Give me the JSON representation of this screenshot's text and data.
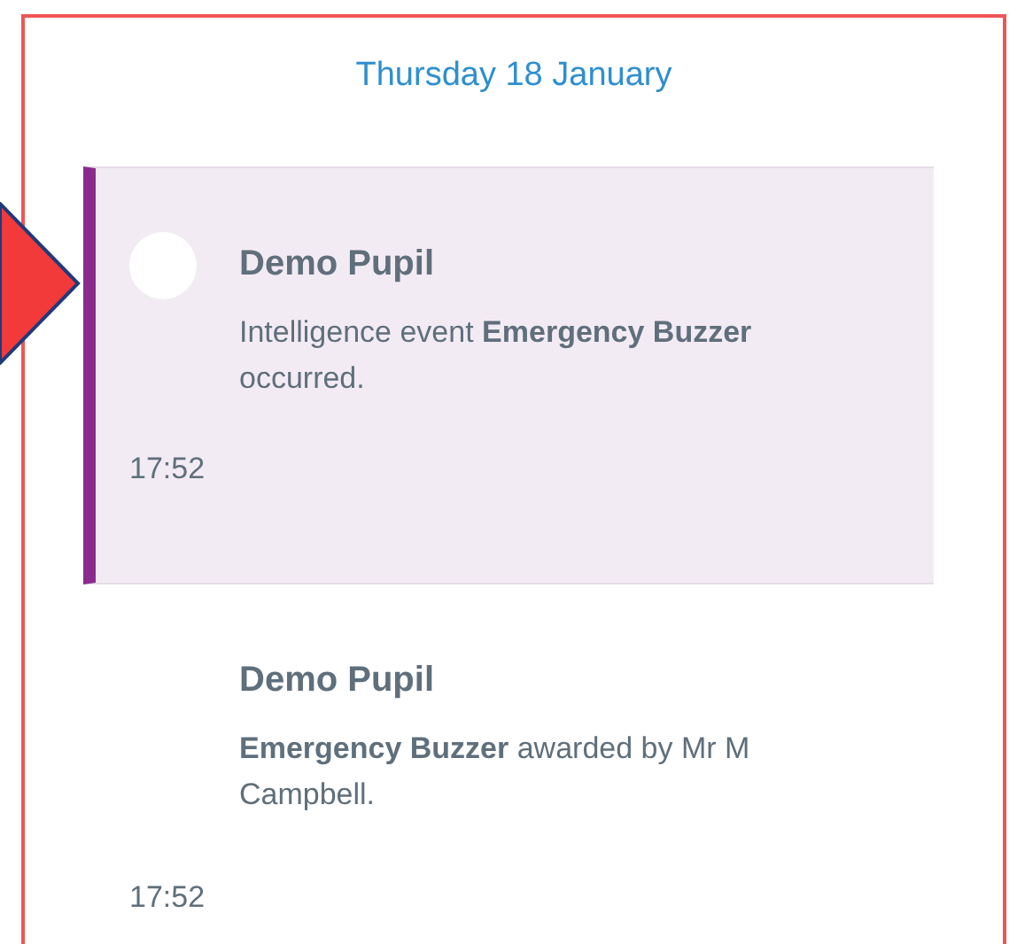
{
  "date": "Thursday 18 January",
  "events": [
    {
      "name": "Demo Pupil",
      "text": "Intelligence event **Emergency Buzzer** occurred.",
      "time": "17:52",
      "selected": true
    },
    {
      "name": "Demo Pupil",
      "text": "**Emergency Buzzer** awarded by Mr M Campbell.",
      "time": "17:52",
      "selected": false
    }
  ]
}
